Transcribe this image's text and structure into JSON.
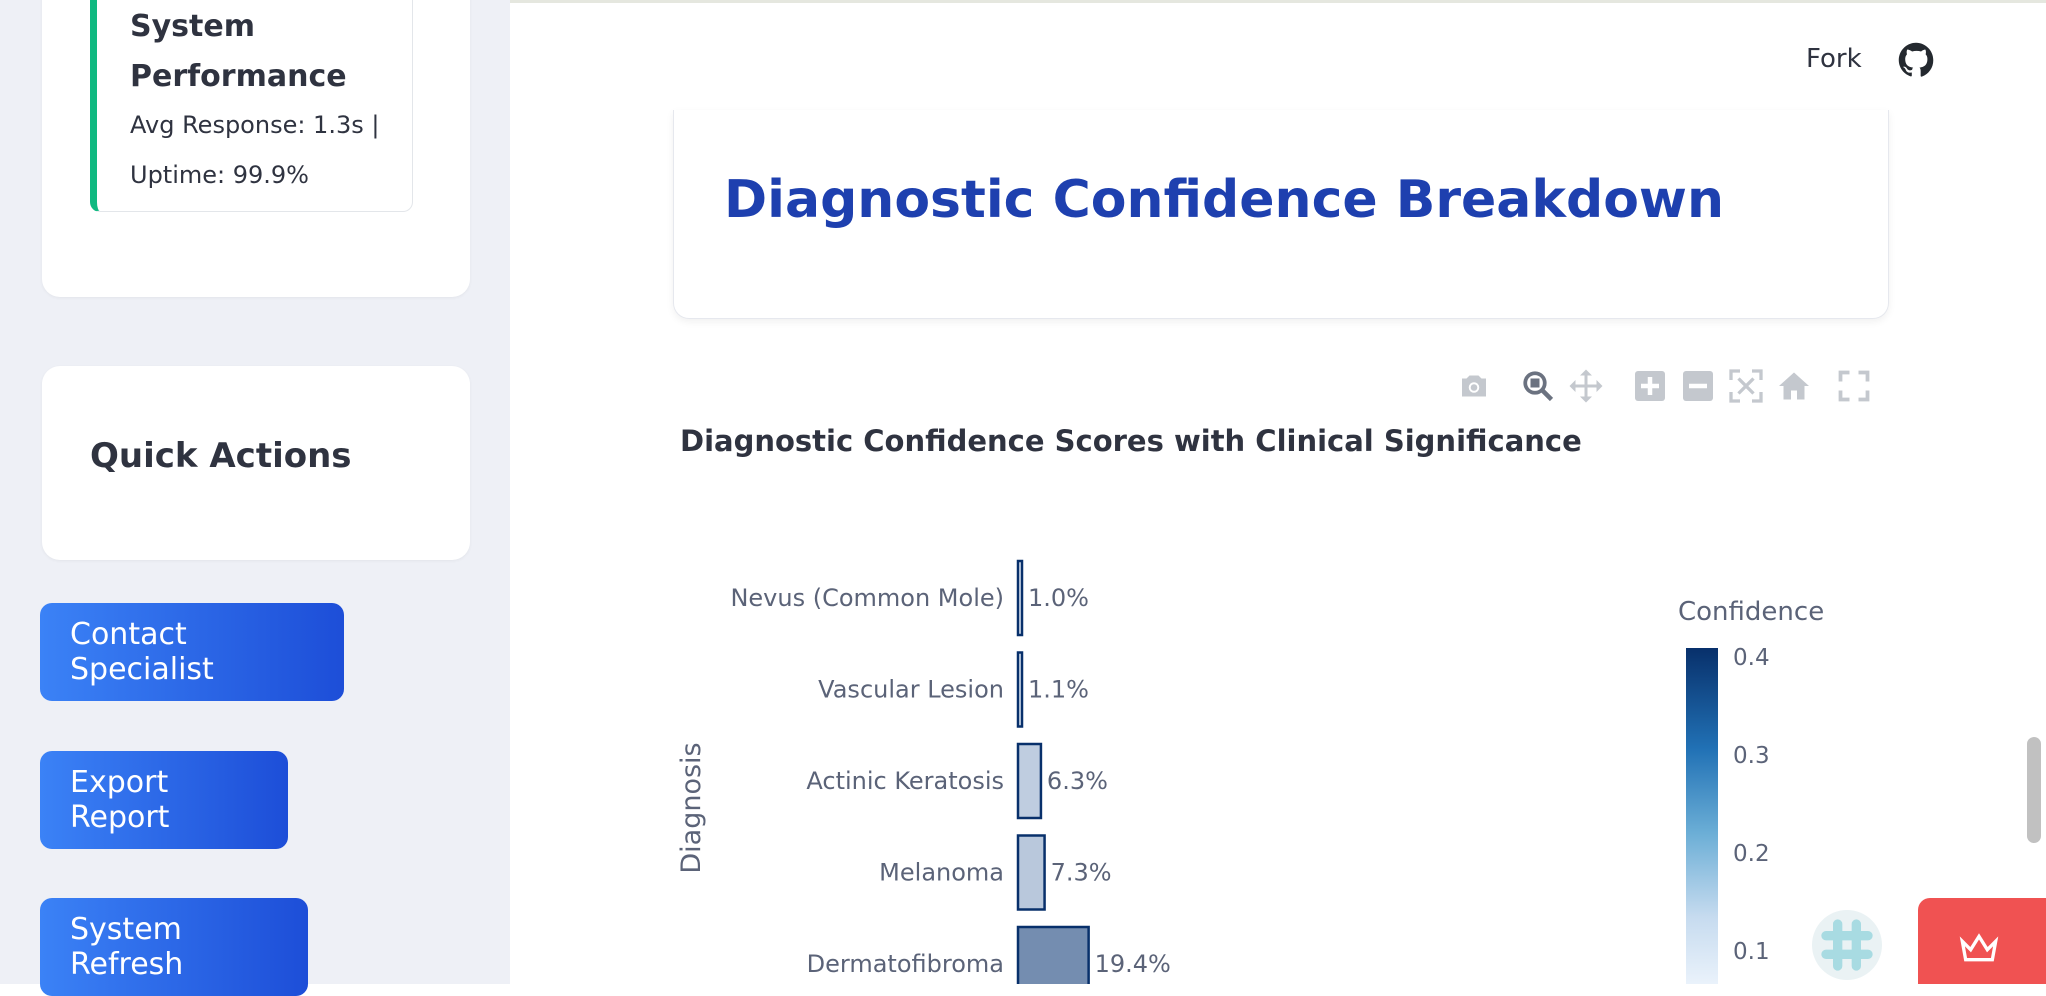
{
  "sidebar": {
    "performance": {
      "title": "System Performance",
      "avg_response": "Avg Response: 1.3s |",
      "uptime": "Uptime: 99.9%"
    },
    "quick_actions": {
      "title": "Quick Actions"
    },
    "buttons": {
      "contact": "Contact Specialist",
      "export": "Export Report",
      "refresh": "System Refresh"
    }
  },
  "header": {
    "fork_label": "Fork"
  },
  "section": {
    "title": "Diagnostic Confidence Breakdown"
  },
  "chart_data": {
    "type": "bar",
    "orientation": "horizontal",
    "title": "Diagnostic Confidence Scores with Clinical Significance",
    "ylabel": "Diagnosis",
    "categories": [
      "Nevus (Common Mole)",
      "Vascular Lesion",
      "Actinic Keratosis",
      "Melanoma",
      "Dermatofibroma"
    ],
    "values": [
      0.01,
      0.011,
      0.063,
      0.073,
      0.194
    ],
    "data_labels": [
      "1.0%",
      "1.1%",
      "6.3%",
      "7.3%",
      "19.4%"
    ],
    "colorbar": {
      "title": "Confidence",
      "ticks": [
        "0.4",
        "0.3",
        "0.2",
        "0.1"
      ],
      "colorscale": "Blues"
    },
    "colors": {
      "bar_stroke": "#08306b",
      "bar_light": "#dbe9f6",
      "bar_mid": "#7ab8dc"
    }
  }
}
